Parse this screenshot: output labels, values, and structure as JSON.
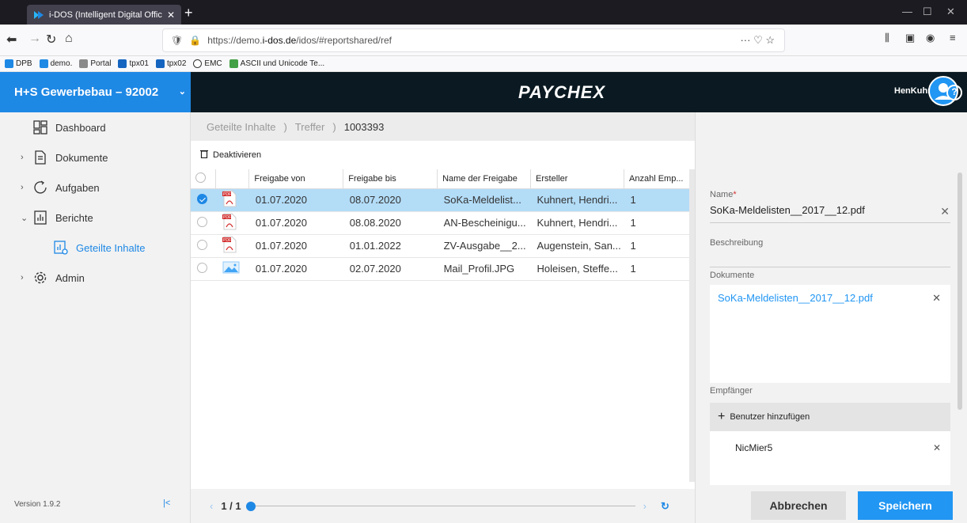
{
  "browser": {
    "tab_title": "i-DOS (Intelligent Digital Offic",
    "url_prefix": "https://demo.",
    "url_domain": "i-dos.de",
    "url_path": "/idos/#reportshared/ref",
    "bookmarks": [
      "DPB",
      "demo.",
      "Portal",
      "tpx01",
      "tpx02",
      "EMC",
      "ASCII und Unicode Te..."
    ]
  },
  "header": {
    "company": "H+S Gewerbebau – 92002",
    "brand": "PAYCHEX",
    "username": "HenKuhn68"
  },
  "sidebar": {
    "items": [
      {
        "label": "Dashboard"
      },
      {
        "label": "Dokumente"
      },
      {
        "label": "Aufgaben"
      },
      {
        "label": "Berichte"
      },
      {
        "label": "Geteilte Inhalte"
      },
      {
        "label": "Admin"
      }
    ],
    "version": "Version 1.9.2"
  },
  "breadcrumb": {
    "items": [
      "Geteilte Inhalte",
      "Treffer",
      "1003393"
    ]
  },
  "toolbar": {
    "deactivate": "Deaktivieren"
  },
  "table": {
    "headers": [
      "Freigabe von",
      "Freigabe bis",
      "Name der Freigabe",
      "Ersteller",
      "Anzahl Emp..."
    ],
    "rows": [
      {
        "from": "01.07.2020",
        "to": "08.07.2020",
        "name": "SoKa-Meldelist...",
        "creator": "Kuhnert, Hendri...",
        "count": "1",
        "type": "pdf",
        "selected": true
      },
      {
        "from": "01.07.2020",
        "to": "08.08.2020",
        "name": "AN-Bescheinigu...",
        "creator": "Kuhnert, Hendri...",
        "count": "1",
        "type": "pdf",
        "selected": false
      },
      {
        "from": "01.07.2020",
        "to": "01.01.2022",
        "name": "ZV-Ausgabe__2...",
        "creator": "Augenstein, San...",
        "count": "1",
        "type": "pdf",
        "selected": false
      },
      {
        "from": "01.07.2020",
        "to": "02.07.2020",
        "name": "Mail_Profil.JPG",
        "creator": "Holeisen, Steffe...",
        "count": "1",
        "type": "image",
        "selected": false
      }
    ]
  },
  "pager": {
    "page": "1 / 1"
  },
  "panel": {
    "name_label": "Name",
    "name_value": "SoKa-Meldelisten__2017__12.pdf",
    "desc_label": "Beschreibung",
    "docs_label": "Dokumente",
    "doc_link": "SoKa-Meldelisten__2017__12.pdf",
    "recipients_label": "Empfänger",
    "add_user": "Benutzer hinzufügen",
    "recipient": "NicMier5",
    "cancel": "Abbrechen",
    "save": "Speichern"
  },
  "colors": {
    "accent": "#1e88e5",
    "header_bg": "#0b1a22",
    "selected_row": "#b3dcf7"
  }
}
